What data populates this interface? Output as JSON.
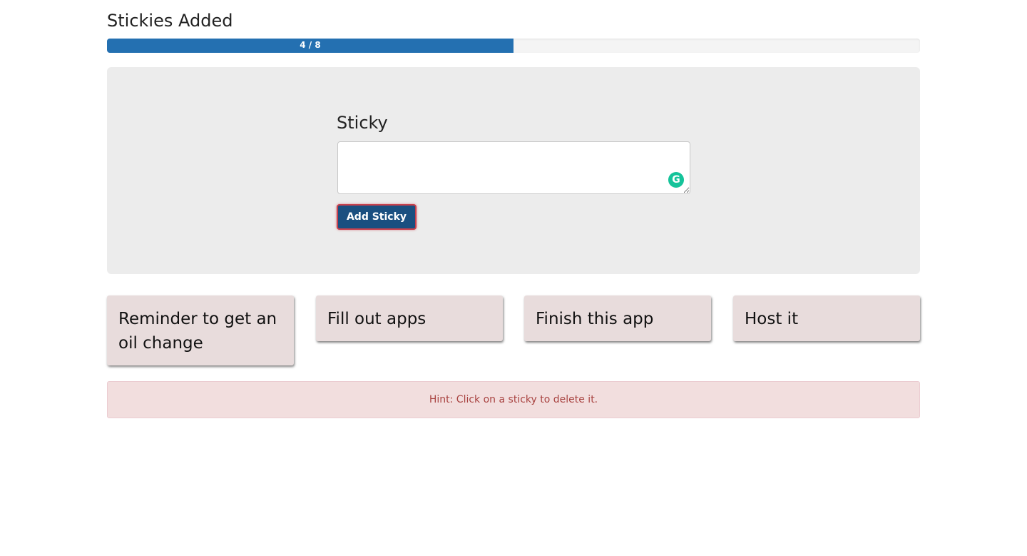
{
  "header": {
    "title": "Stickies Added"
  },
  "progress": {
    "label": "4 / 8",
    "current": 4,
    "total": 8,
    "color": "#2470b1"
  },
  "form": {
    "label": "Sticky",
    "input_value": "",
    "add_button": "Add Sticky",
    "grammarly_icon": "G"
  },
  "stickies": [
    "Reminder to get an oil change",
    "Fill out apps",
    "Finish this app",
    "Host it"
  ],
  "hint": "Hint: Click on a sticky to delete it."
}
